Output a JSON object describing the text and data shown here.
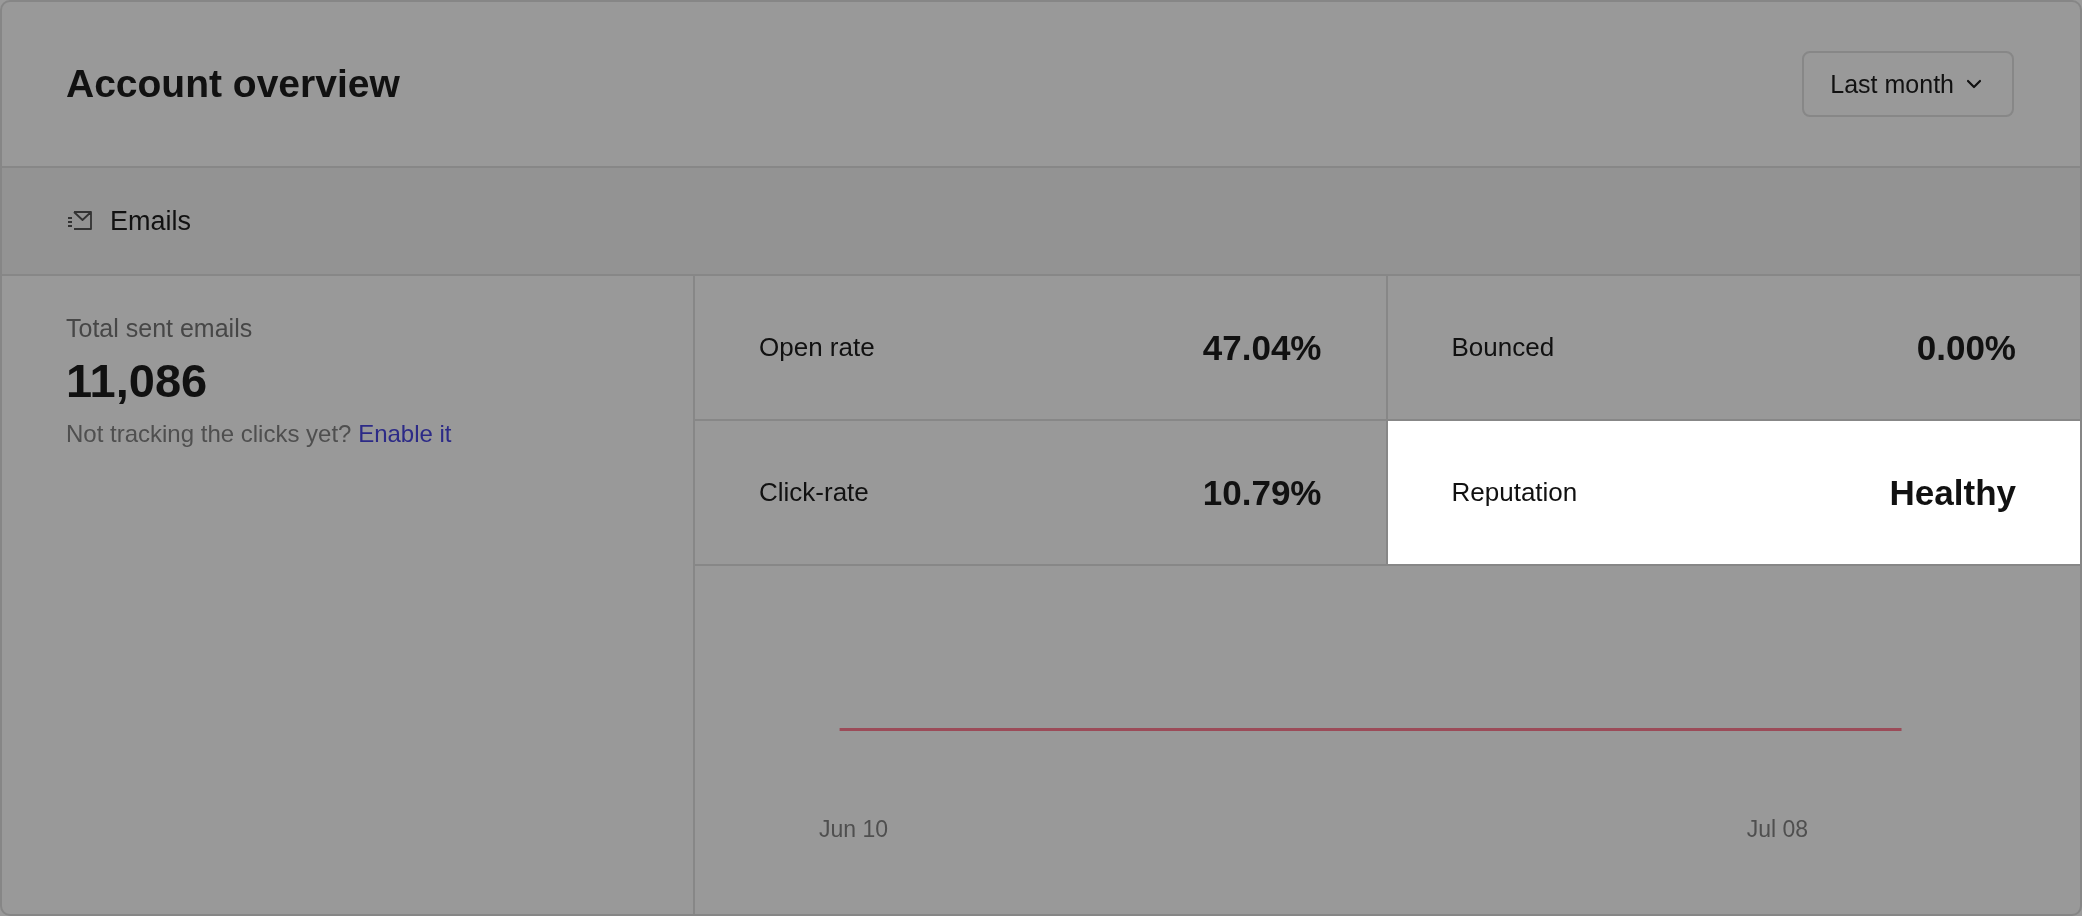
{
  "header": {
    "title": "Account overview",
    "period_dropdown": {
      "value": "Last month"
    }
  },
  "section": {
    "label": "Emails"
  },
  "total": {
    "label": "Total sent emails",
    "value": "11,086",
    "note": "Not tracking the clicks yet?",
    "link": "Enable it"
  },
  "metrics": [
    {
      "label": "Open rate",
      "value": "47.04%",
      "highlighted": false
    },
    {
      "label": "Bounced",
      "value": "0.00%",
      "highlighted": false
    },
    {
      "label": "Click-rate",
      "value": "10.79%",
      "highlighted": false
    },
    {
      "label": "Reputation",
      "value": "Healthy",
      "highlighted": true
    }
  ],
  "chart": {
    "x_labels": [
      "Jun 10",
      "Jul 08"
    ]
  }
}
